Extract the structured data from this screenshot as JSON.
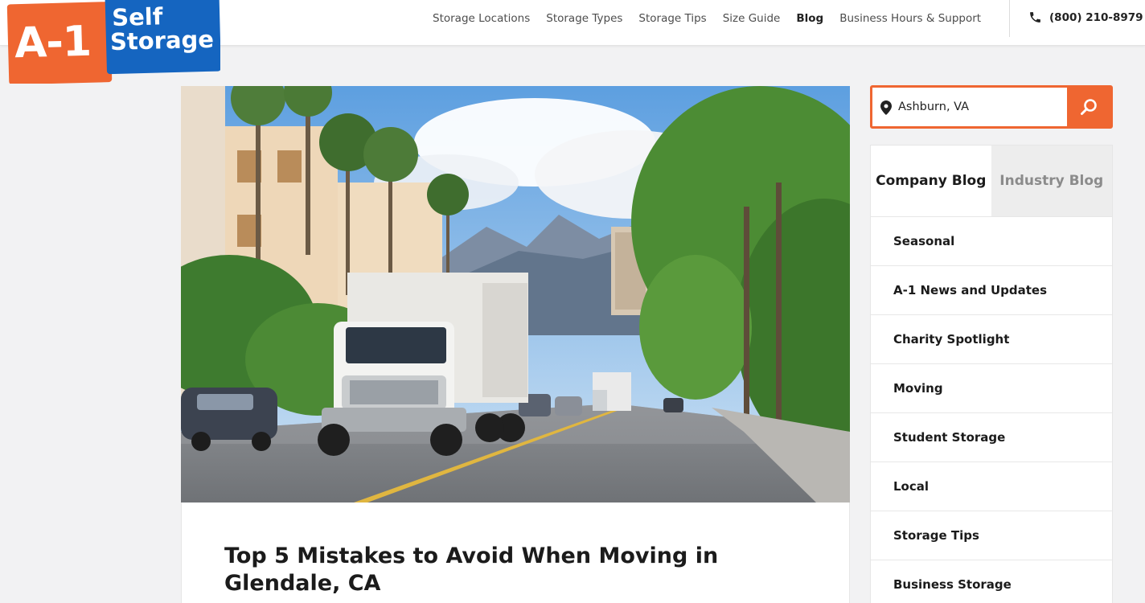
{
  "logo": {
    "line1": "A-1",
    "line2": "Self",
    "line3": "Storage"
  },
  "nav": {
    "items": [
      {
        "label": "Storage Locations"
      },
      {
        "label": "Storage Types"
      },
      {
        "label": "Storage Tips"
      },
      {
        "label": "Size Guide"
      },
      {
        "label": "Blog",
        "active": true
      },
      {
        "label": "Business Hours & Support"
      }
    ],
    "phone": "(800) 210-8979"
  },
  "search": {
    "value": "Ashburn, VA",
    "icon": "search-icon"
  },
  "tabs": {
    "company": "Company Blog",
    "industry": "Industry Blog"
  },
  "categories": [
    "Seasonal",
    "A-1 News and Updates",
    "Charity Spotlight",
    "Moving",
    "Student Storage",
    "Local",
    "Storage Tips",
    "Business Storage"
  ],
  "article": {
    "title": "Top 5 Mistakes to Avoid When Moving in Glendale, CA"
  },
  "colors": {
    "accent": "#ef6631",
    "brand_blue": "#1565c0",
    "brand_orange": "#ef6631"
  }
}
